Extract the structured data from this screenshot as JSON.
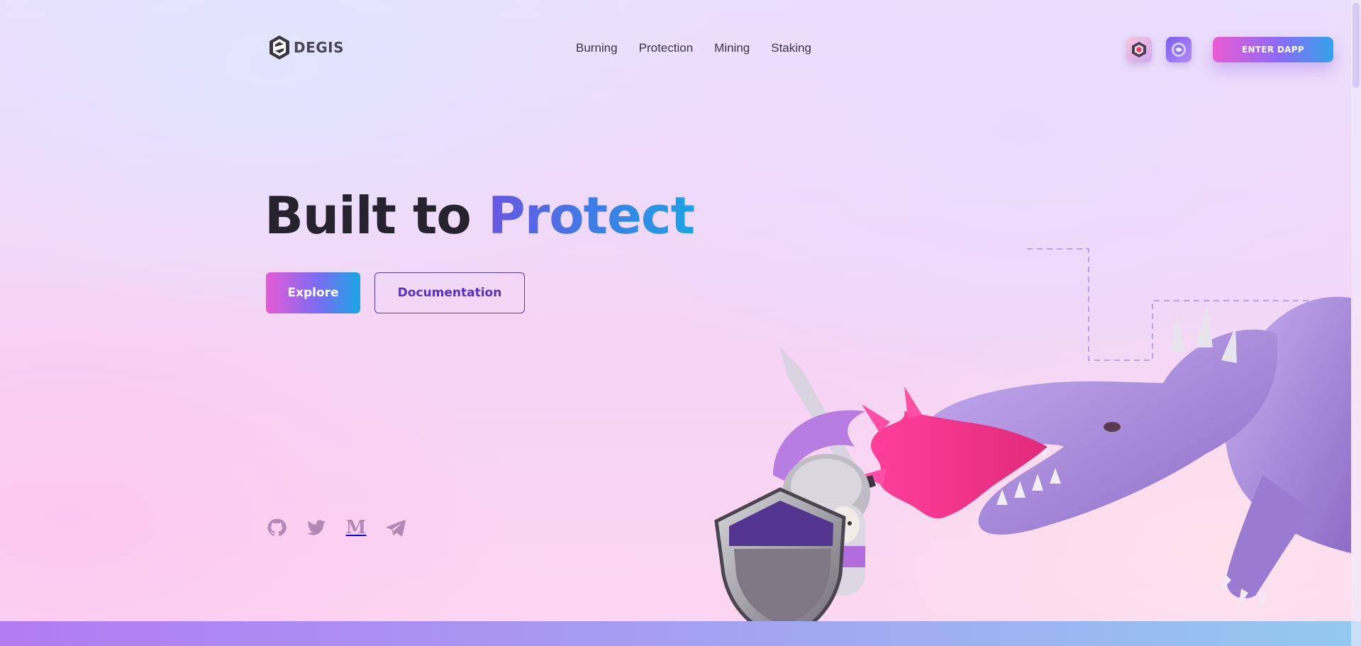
{
  "brand": {
    "name": "DEGIS"
  },
  "nav": {
    "items": [
      {
        "label": "Burning"
      },
      {
        "label": "Protection"
      },
      {
        "label": "Mining"
      },
      {
        "label": "Staking"
      }
    ]
  },
  "header": {
    "enter_label": "ENTER DAPP",
    "wallet_icons": [
      "degis-token-icon",
      "network-token-icon"
    ]
  },
  "hero": {
    "title_plain": "Built to ",
    "title_highlight": "Protect",
    "explore_label": "Explore",
    "docs_label": "Documentation"
  },
  "socials": {
    "items": [
      "github-icon",
      "twitter-icon",
      "medium-icon",
      "telegram-icon"
    ],
    "medium_letter": "M"
  },
  "colors": {
    "accent_pink": "#ea5bd3",
    "accent_purple": "#7a6cf2",
    "accent_blue": "#1aa6e6",
    "title_dark": "#26222e",
    "docs_border": "#5a36b8"
  }
}
